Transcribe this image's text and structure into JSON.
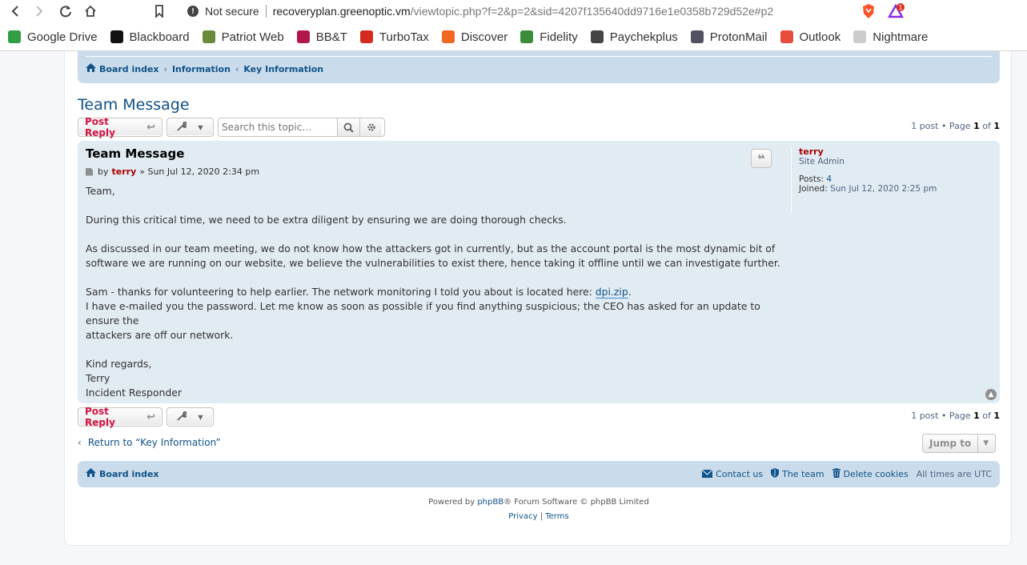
{
  "browser": {
    "url_warning": "Not secure",
    "url_host": "recoveryplan.greenoptic.vm",
    "url_path": "/viewtopic.php?f=2&p=2&sid=4207f135640dd9716e1e0358b729d52e#p2",
    "ext_badge": "1",
    "bookmarks": [
      {
        "label": "Google Drive",
        "color": "#2f9e44"
      },
      {
        "label": "Blackboard",
        "color": "#111111"
      },
      {
        "label": "Patriot Web",
        "color": "#6a8b3a"
      },
      {
        "label": "BB&T",
        "color": "#b0184d"
      },
      {
        "label": "TurboTax",
        "color": "#d52b1e"
      },
      {
        "label": "Discover",
        "color": "#f26722"
      },
      {
        "label": "Fidelity",
        "color": "#3b8c3b"
      },
      {
        "label": "Paychekplus",
        "color": "#444444"
      },
      {
        "label": "ProtonMail",
        "color": "#505264"
      },
      {
        "label": "Outlook",
        "color": "#e74c3c"
      },
      {
        "label": "Nightmare",
        "color": "#cccccc"
      }
    ]
  },
  "breadcrumb": {
    "board_index": "Board index",
    "forum": "Information",
    "subforum": "Key Information"
  },
  "topic": {
    "title": "Team Message",
    "post_reply": "Post Reply",
    "search_placeholder": "Search this topic…",
    "pagination": {
      "prefix": "1 post • Page",
      "page": "1",
      "of": "of",
      "total": "1"
    }
  },
  "post": {
    "title": "Team Message",
    "by": "by",
    "author": "terry",
    "date": "» Sun Jul 12, 2020 2:34 pm",
    "lines": {
      "l1": "Team,",
      "l2": "During this critical time, we need to be extra diligent by ensuring we are doing thorough checks.",
      "l3a": "As discussed in our team meeting, we do not know how the attackers got in currently, but as the account portal is the most dynamic bit of",
      "l3b": "software we are running on our website, we believe the vulnerabilities to exist there, hence taking it offline until we can investigate further.",
      "l4a": "Sam - thanks for volunteering to help earlier. The network monitoring I told you about is located here: ",
      "link": "dpi.zip",
      "l4b": ".",
      "l5a": "I have e-mailed you the password. Let me know as soon as possible if you find anything suspicious; the CEO has asked for an update to ensure the",
      "l5b": "attackers are off our network.",
      "l6": "Kind regards,",
      "l7": "Terry",
      "l8": "Incident Responder"
    },
    "profile": {
      "username": "terry",
      "rank": "Site Admin",
      "posts_label": "Posts:",
      "posts": "4",
      "joined_label": "Joined:",
      "joined": "Sun Jul 12, 2020 2:25 pm"
    }
  },
  "bottom": {
    "return_link": "Return to “Key Information”",
    "jump_to": "Jump to"
  },
  "footer": {
    "board_index": "Board index",
    "contact": "Contact us",
    "team": "The team",
    "delete_cookies": "Delete cookies",
    "timezone": "All times are UTC",
    "powered_pre": "Powered by ",
    "phpbb": "phpBB",
    "powered_post": "® Forum Software © phpBB Limited",
    "privacy": "Privacy",
    "sep": " | ",
    "terms": "Terms"
  }
}
